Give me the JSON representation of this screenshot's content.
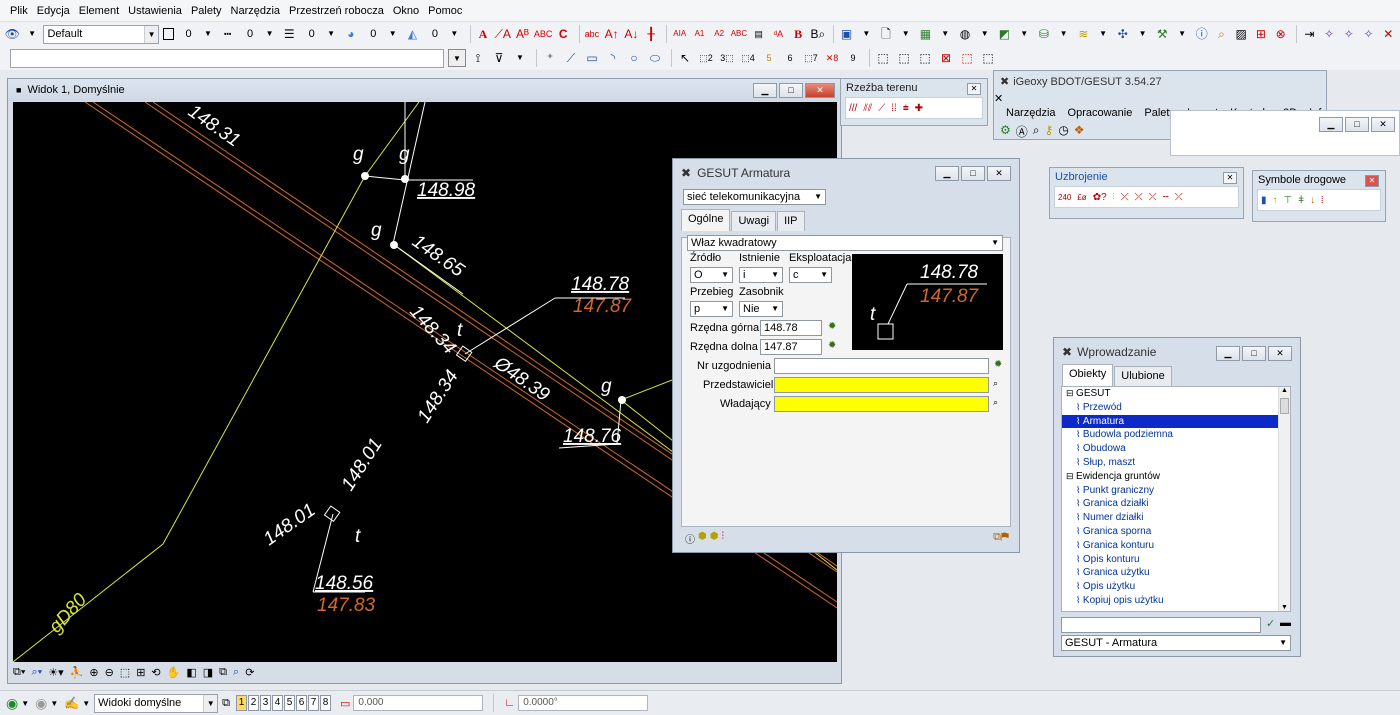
{
  "menu": [
    "Plik",
    "Edycja",
    "Element",
    "Ustawienia",
    "Palety",
    "Narzędzia",
    "Przestrzeń robocza",
    "Okno",
    "Pomoc"
  ],
  "toolbar": {
    "level_value": "Default",
    "color_value": "0",
    "style_value": "0",
    "weight_value": "0",
    "trans_value": "0",
    "prio_value": "0"
  },
  "view": {
    "title": "Widok 1, Domyślnie",
    "labels": {
      "l1": "148.31",
      "l2": "148.98",
      "l3": "148.65",
      "l4": "148.78",
      "l5": "147.87",
      "l6": "148.34",
      "l7": "148.34",
      "l8": "Ø48.39",
      "l9": "148.76",
      "l10": "148.01",
      "l11": "148.01",
      "l12": "148.56",
      "l13": "147.83",
      "l14": "gD80",
      "g": "g",
      "t": "t"
    }
  },
  "terrain_palette": {
    "title": "Rzeźba terenu"
  },
  "igeoxy": {
    "title": "iGeoxy BDOT/GESUT 3.54.27",
    "menu": [
      "Narzędzia",
      "Opracowanie",
      "Palety",
      "Import",
      "Kontrole",
      "3D",
      "Info"
    ]
  },
  "uzbrojenie": {
    "title": "Uzbrojenie"
  },
  "symbole": {
    "title": "Symbole drogowe"
  },
  "armatura": {
    "title": "GESUT Armatura",
    "network": "sieć telekomunikacyjna",
    "tabs": [
      "Ogólne",
      "Uwagi",
      "IIP"
    ],
    "type": "Właz kwadratowy",
    "zrodlo_label": "Źródło",
    "istnienie_label": "Istnienie",
    "eksploatacja_label": "Eksploatacja",
    "zrodlo": "O",
    "istnienie": "i",
    "eksploatacja": "c",
    "przebieg_label": "Przebieg",
    "zasobnik_label": "Zasobnik",
    "przebieg": "p",
    "zasobnik": "Nie",
    "rzedna_gorna_label": "Rzędna górna",
    "rzedna_gorna": "148.78",
    "rzedna_dolna_label": "Rzędna dolna",
    "rzedna_dolna": "147.87",
    "nr_uzg_label": "Nr uzgodnienia",
    "nr_uzg": "",
    "przedstawiciel_label": "Przedstawiciel",
    "przedstawiciel": "",
    "wladajacy_label": "Władający",
    "wladajacy": "",
    "preview_top": "148.78",
    "preview_bottom": "147.87",
    "preview_t": "t"
  },
  "wprowadzanie": {
    "title": "Wprowadzanie",
    "tabs": [
      "Obiekty",
      "Ulubione"
    ],
    "tree": [
      {
        "label": "GESUT",
        "kind": "hdr"
      },
      {
        "label": "Przewód",
        "kind": "item"
      },
      {
        "label": "Armatura",
        "kind": "selected"
      },
      {
        "label": "Budowla podziemna",
        "kind": "item"
      },
      {
        "label": "Obudowa",
        "kind": "item"
      },
      {
        "label": "Słup, maszt",
        "kind": "item"
      },
      {
        "label": "Ewidencja gruntów",
        "kind": "hdr"
      },
      {
        "label": "Punkt graniczny",
        "kind": "item"
      },
      {
        "label": "Granica działki",
        "kind": "item"
      },
      {
        "label": "Numer działki",
        "kind": "item"
      },
      {
        "label": "Granica sporna",
        "kind": "item"
      },
      {
        "label": "Granica konturu",
        "kind": "item"
      },
      {
        "label": "Opis konturu",
        "kind": "item"
      },
      {
        "label": "Granica użytku",
        "kind": "item"
      },
      {
        "label": "Opis użytku",
        "kind": "item"
      },
      {
        "label": "Kopiuj opis użytku",
        "kind": "item"
      }
    ],
    "search_value": "",
    "bottom_select": "GESUT - Armatura"
  },
  "status": {
    "views_label": "Widoki domyślne",
    "pages": [
      "1",
      "2",
      "3",
      "4",
      "5",
      "6",
      "7",
      "8"
    ],
    "active_page": "1",
    "coord_value": "0.000",
    "angle_value": "0.0000°"
  }
}
